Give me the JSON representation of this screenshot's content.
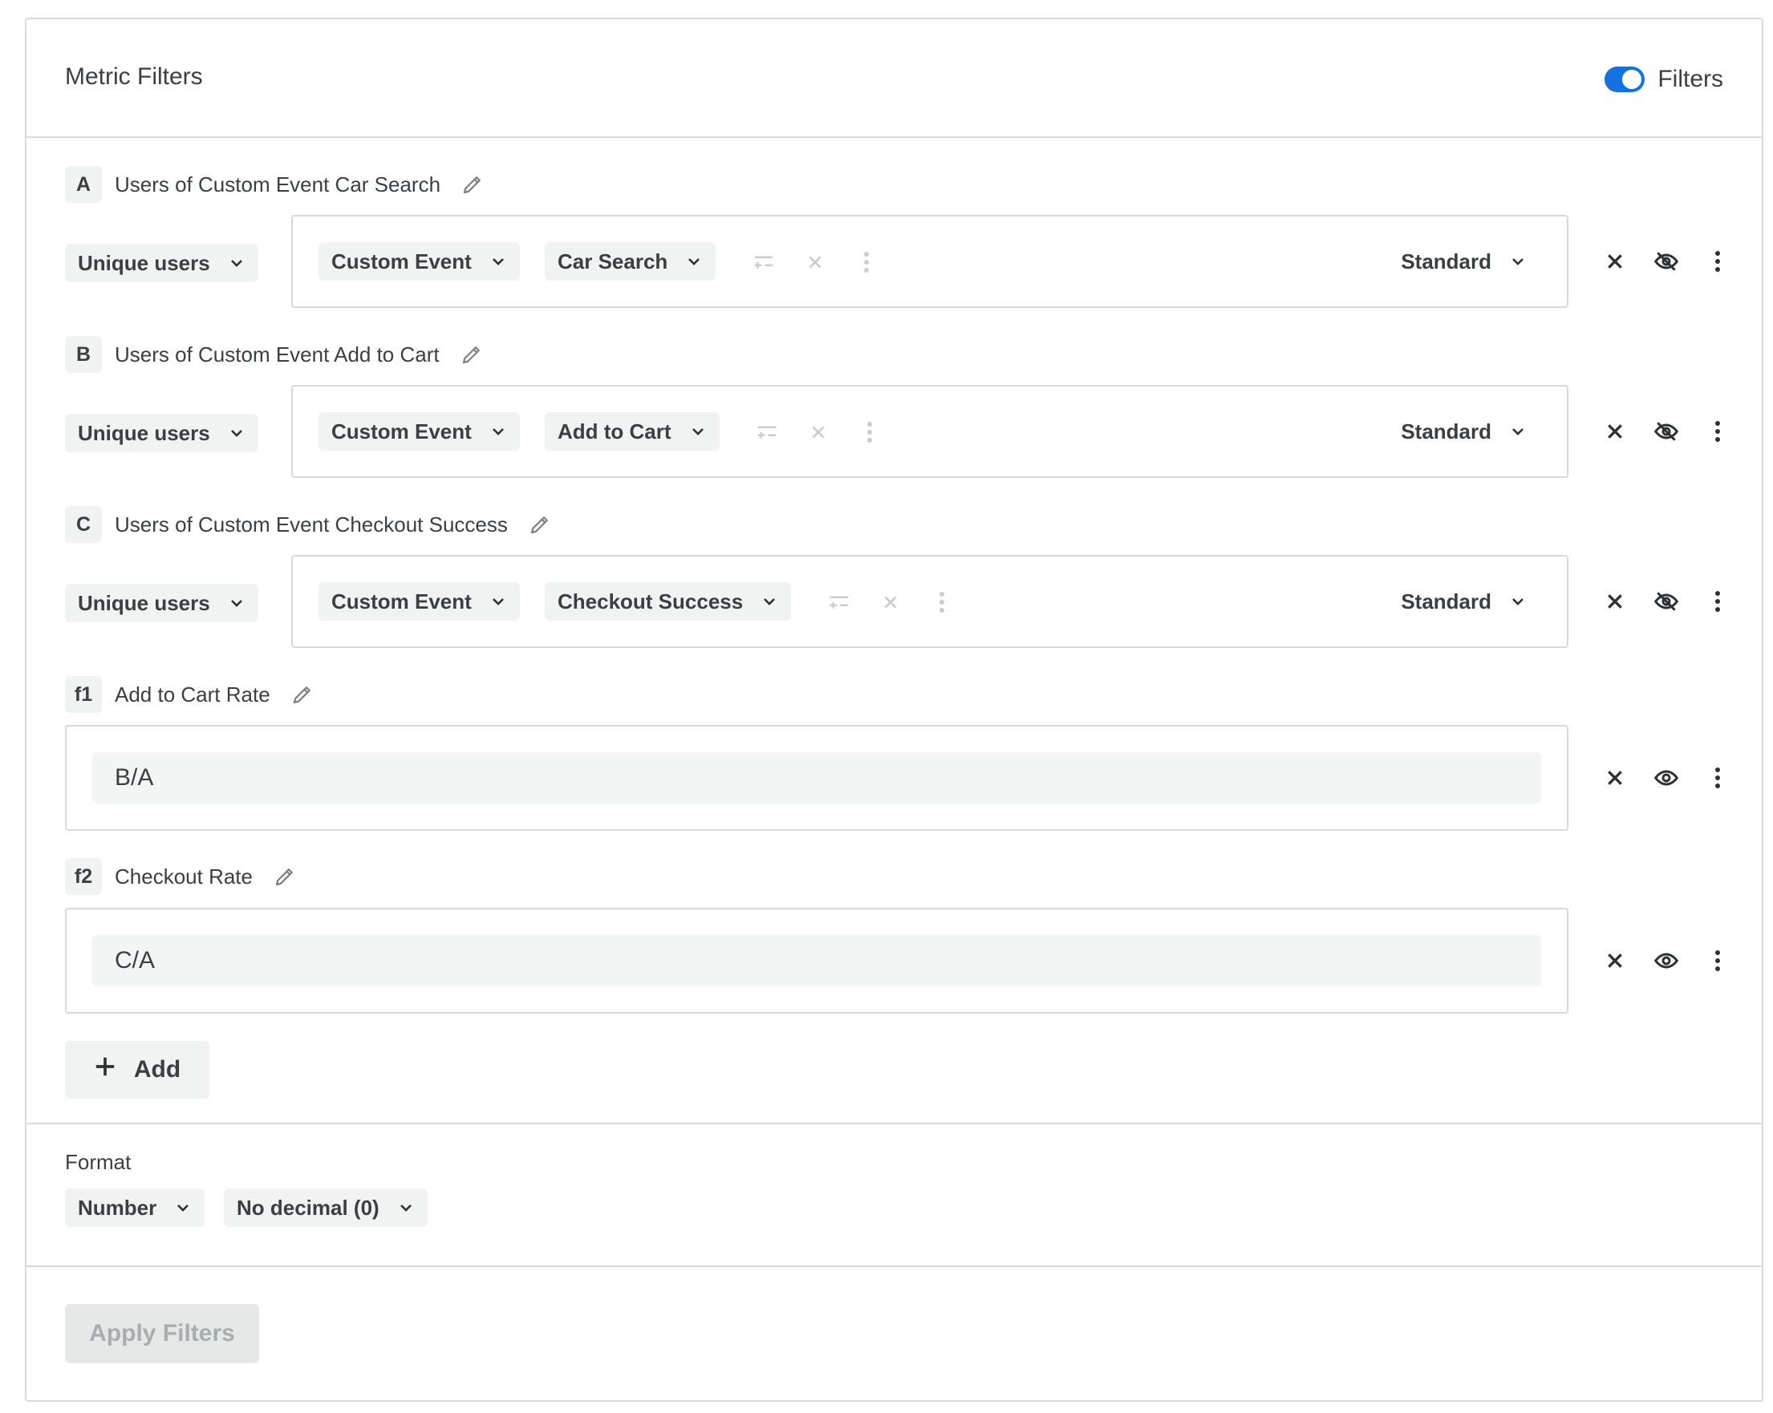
{
  "header": {
    "title": "Metric Filters",
    "toggle_label": "Filters",
    "toggle_on": true
  },
  "metrics": [
    {
      "letter": "A",
      "name": "Users of Custom Event Car Search",
      "measure": "Unique users",
      "event_type": "Custom Event",
      "event_name": "Car Search",
      "mode": "Standard",
      "visible": false
    },
    {
      "letter": "B",
      "name": "Users of Custom Event Add to Cart",
      "measure": "Unique users",
      "event_type": "Custom Event",
      "event_name": "Add to Cart",
      "mode": "Standard",
      "visible": false
    },
    {
      "letter": "C",
      "name": "Users of Custom Event Checkout Success",
      "measure": "Unique users",
      "event_type": "Custom Event",
      "event_name": "Checkout Success",
      "mode": "Standard",
      "visible": false
    }
  ],
  "formulas": [
    {
      "letter": "f1",
      "name": "Add to Cart Rate",
      "expression": "B/A",
      "visible": true
    },
    {
      "letter": "f2",
      "name": "Checkout Rate",
      "expression": "C/A",
      "visible": true
    }
  ],
  "add_label": "Add",
  "format": {
    "label": "Format",
    "type": "Number",
    "decimals": "No decimal (0)"
  },
  "apply_label": "Apply Filters",
  "colors": {
    "accent": "#1472e0",
    "border": "#d7dadc",
    "pill_bg": "#f1f3f3",
    "text": "#3a3f43",
    "disabled_text": "#a8adb0"
  }
}
